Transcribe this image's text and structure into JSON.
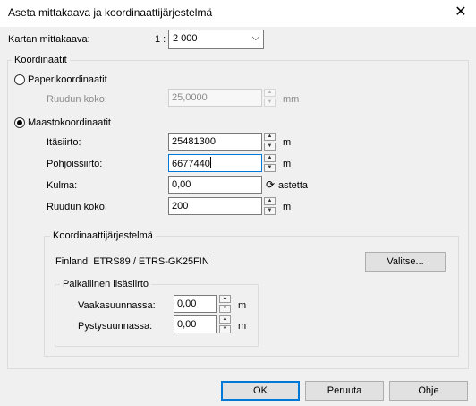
{
  "window": {
    "title": "Aseta mittakaava ja koordinaattijärjestelmä",
    "close": "✕"
  },
  "scale": {
    "label": "Kartan mittakaava:",
    "prefix": "1 :",
    "value": "2 000"
  },
  "coords": {
    "group_label": "Koordinaatit",
    "paper": {
      "label": "Paperikoordinaatit",
      "grid_label": "Ruudun koko:",
      "grid_value": "25,0000",
      "grid_unit": "mm"
    },
    "terrain": {
      "label": "Maastokoordinaatit",
      "east_label": "Itäsiirto:",
      "east_value": "25481300",
      "east_unit": "m",
      "north_label": "Pohjoissiirto:",
      "north_value": "6677440",
      "north_unit": "m",
      "angle_label": "Kulma:",
      "angle_value": "0,00",
      "angle_unit": "astetta",
      "grid_label": "Ruudun koko:",
      "grid_value": "200",
      "grid_unit": "m"
    },
    "crs": {
      "group_label": "Koordinaattijärjestelmä",
      "name": "Finland  ETRS89 / ETRS-GK25FIN",
      "select_button": "Valitse...",
      "local": {
        "group_label": "Paikallinen lisäsiirto",
        "horiz_label": "Vaakasuunnassa:",
        "horiz_value": "0,00",
        "horiz_unit": "m",
        "vert_label": "Pystysuunnassa:",
        "vert_value": "0,00",
        "vert_unit": "m"
      }
    }
  },
  "buttons": {
    "ok": "OK",
    "cancel": "Peruuta",
    "help": "Ohje"
  }
}
